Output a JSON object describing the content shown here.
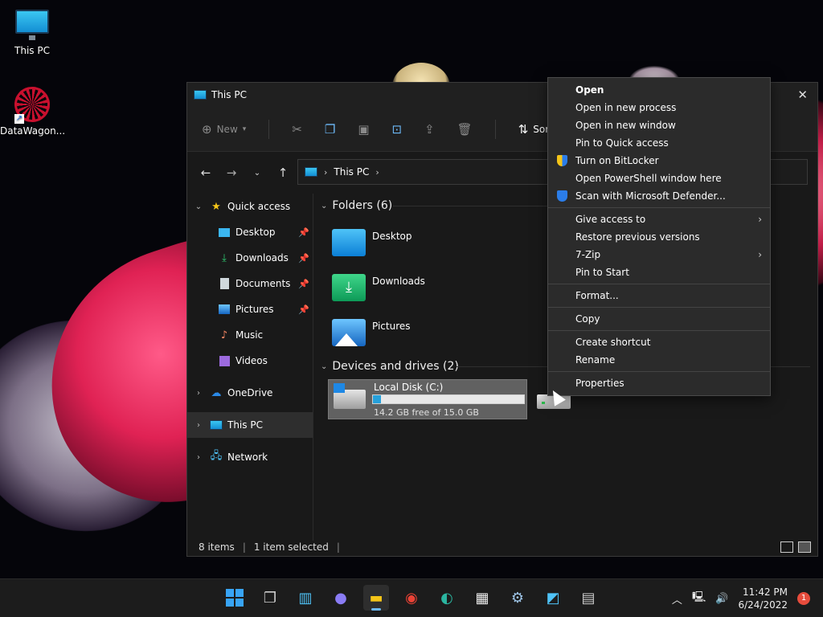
{
  "desktop": {
    "icons": [
      {
        "label": "This PC"
      },
      {
        "label": "DataWagon..."
      }
    ]
  },
  "window": {
    "title": "This PC",
    "close_glyph": "✕",
    "toolbar": {
      "new_label": "New",
      "sort_label": "Sort"
    },
    "address": {
      "segment": "This PC"
    },
    "nav": {
      "quick_access": "Quick access",
      "items": [
        {
          "label": "Desktop",
          "pinned": true
        },
        {
          "label": "Downloads",
          "pinned": true
        },
        {
          "label": "Documents",
          "pinned": true
        },
        {
          "label": "Pictures",
          "pinned": true
        },
        {
          "label": "Music",
          "pinned": false
        },
        {
          "label": "Videos",
          "pinned": false
        }
      ],
      "onedrive": "OneDrive",
      "this_pc": "This PC",
      "network": "Network"
    },
    "folders_header": "Folders (6)",
    "folders": [
      {
        "name": "Desktop"
      },
      {
        "name": "Downloads"
      },
      {
        "name": "Pictures"
      }
    ],
    "devices_header": "Devices and drives (2)",
    "drive": {
      "name": "Local Disk (C:)",
      "free_text": "14.2 GB free of 15.0 GB",
      "used_fraction": 0.053
    },
    "status": {
      "items": "8 items",
      "selected": "1 item selected"
    }
  },
  "context_menu": {
    "items": [
      {
        "label": "Open",
        "bold": true
      },
      {
        "label": "Open in new process"
      },
      {
        "label": "Open in new window"
      },
      {
        "label": "Pin to Quick access"
      },
      {
        "label": "Turn on BitLocker",
        "icon": "shield-icon"
      },
      {
        "label": "Open PowerShell window here"
      },
      {
        "label": "Scan with Microsoft Defender...",
        "icon": "defender-icon"
      },
      {
        "label": "Give access to",
        "submenu": true
      },
      {
        "label": "Restore previous versions"
      },
      {
        "label": "7-Zip",
        "submenu": true
      },
      {
        "label": "Pin to Start"
      },
      {
        "label": "Format..."
      },
      {
        "label": "Copy"
      },
      {
        "label": "Create shortcut"
      },
      {
        "label": "Rename"
      },
      {
        "label": "Properties"
      }
    ]
  },
  "taskbar": {
    "time": "11:42 PM",
    "date": "6/24/2022",
    "notification_count": "1"
  },
  "colors": {
    "accent": "#26a0da",
    "window_bg": "#191919",
    "menu_bg": "#2b2b2b"
  }
}
